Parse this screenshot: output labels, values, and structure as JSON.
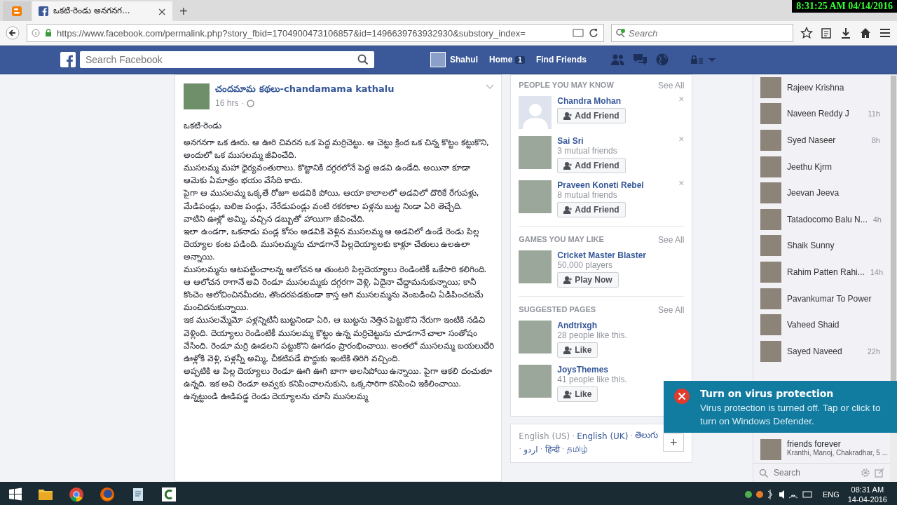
{
  "recorder_clock": "8:31:25 AM 04/14/2016",
  "browser": {
    "tabs": [
      {
        "kind": "pinned",
        "selected": false
      },
      {
        "kind": "page",
        "title": "ఒకటి-రెండు అనగనగ...",
        "close": "×",
        "selected": true
      }
    ],
    "new_tab": "+",
    "url": "https://www.facebook.com/permalink.php?story_fbid=1704900473106857&id=1496639763932930&substory_index=",
    "search_placeholder": "Search"
  },
  "facebook": {
    "search_placeholder": "Search Facebook",
    "user": "Shahul",
    "nav": [
      {
        "label": "Home",
        "badge": "1"
      },
      {
        "label": "Find Friends"
      }
    ]
  },
  "post": {
    "page_name": "చందమామ కథలు-chandamama kathalu",
    "time": "16 hrs",
    "separator": "·",
    "title": "ఒకటి-రెండు",
    "paragraphs": [
      "అనగనగా ఒక ఊరు. ఆ ఊరి చివరన ఒక పెద్ద మర్రిచెట్టు. ఆ చెట్టు క్రింద ఒక చిన్న కొట్టం కట్టుకొని, అందులో ఒక ముసలమ్మ జీవించేది.",
      "ముసలమ్మ మహా ధైర్యవంతురాలు. కొట్టానికి దగ్గరలోనే పెద్ద అడవి ఉండేది. అయినా కూడా ఆమెకు ఏమాత్రం భయం వేసేది కాదు.",
      "పైగా ఆ ముసలమ్మ ఒక్కతే రోజూ అడవికి పోయి, ఆయా కాలాలలో అడవిలో దొరికే రేగుపళ్లు, మేడిపండ్లు, బలిజ పండ్లు, నేరేడుపండ్లు వంటి రకరకాల పళ్లను బుట్ట నిండా ఏరి తెచ్చేది.",
      "వాటిని ఊళ్లో అమ్మి, వచ్చిన డబ్బుతో హాయిగా జీవించేది.",
      "ఇలా ఉండగా, ఒకనాడు పండ్ల కోసం అడవికి వెళ్లిన ముసలమ్మ ఆ అడవిలో ఉండే రెండు పిల్ల దెయ్యాల కంట పడింది. ముసలమ్మను చూడగానే పిల్లదెయ్యాలకు కాళ్లూ చేతులు ఉలఉలా అన్నాయి.",
      "ముసలమ్మను ఆటపట్టించాలన్న ఆలోచన ఆ తుంటరి పిల్లదెయ్యాలు రెండింటికీ ఒకేసారి కలిగింది. ఆ ఆలోచన రాగానే అవి రెండూ ముసలమ్మకు దగ్గరగా వెళ్లి, ఏదైనా చేద్దామనుకున్నాయి; కానీ కొంచెం ఆలోచించినమీదట, తొందరపడకుండా కాస్త ఆగి ముసలమ్మను వెంబడించి ఏడిపించటమే మంచిదనుకున్నాయి.",
      "ఇక ముసలమ్మేమో పళ్లన్నిటినీ బుట్టనిండా ఏరి, ఆ బుట్టను నెత్తిన పెట్టుకొని నేరుగా ఇంటికి నడిచి వెళ్లింది. దెయ్యాలు రెండింటికీ ముసలమ్మ కొట్టం ఉన్న మర్రిచెట్టును చూడగానే చాలా సంతోషం వేసింది. రెండూ మర్రి ఊడలని పట్టుకొని ఊగడం ప్రారంభించాయి. అంతలో ముసలమ్మ బయలుదేరి ఊళ్లోకి వెళ్లి, పళ్లన్నీ అమ్మి, చీకటిపడే పొద్దుకు ఇంటికి తిరిగి వచ్చింది.",
      "అప్పటికి ఆ పిల్ల దెయ్యాలు రెండూ ఊగి ఊగి బాగా అలసిపోయి ఉన్నాయి. పైగా ఆకలి దంచుతూ ఉన్నది. ఇక అవి రెండూ అవ్వకు కనిపించాలనుకుని, ఒక్కసారిగా కనిపించి ఇకిలించాయి.",
      "ఉన్నట్టుండి ఊడిపడ్డ రెండు దెయ్యాలను చూసి ముసలమ్మ"
    ]
  },
  "suggestions": [
    {
      "heading": "PEOPLE YOU MAY KNOW",
      "see_all": "See All",
      "items": [
        {
          "kind": "silhouette",
          "name": "Chandra Mohan",
          "action": "Add Friend",
          "dismiss": "×"
        },
        {
          "kind": "photo",
          "name": "Sai Sri",
          "meta": "3 mutual friends",
          "action": "Add Friend",
          "dismiss": "×"
        },
        {
          "kind": "photo",
          "name": "Praveen Koneti Rebel",
          "meta": "8 mutual friends",
          "action": "Add Friend",
          "dismiss": "×"
        }
      ]
    },
    {
      "heading": "GAMES YOU MAY LIKE",
      "see_all": "See All",
      "items": [
        {
          "kind": "photo",
          "name": "Cricket Master Blaster",
          "meta": "50,000 players",
          "action": "Play Now"
        }
      ]
    },
    {
      "heading": "SUGGESTED PAGES",
      "see_all": "See All",
      "items": [
        {
          "kind": "photo",
          "name": "Andtrixgh",
          "meta": "28 people like this.",
          "action": "Like"
        },
        {
          "kind": "photo",
          "name": "JoysThemes",
          "meta": "41 people like this.",
          "action": "Like"
        }
      ]
    }
  ],
  "languages": {
    "separator": "·",
    "items": [
      {
        "label": "English (US)",
        "selected": true
      },
      {
        "label": "English (UK)",
        "selected": false
      },
      {
        "label": "తెలుగు",
        "selected": false
      },
      {
        "label": "اردو",
        "selected": false
      },
      {
        "label": "हिन्दी",
        "selected": false
      },
      {
        "label": "தமிழ்",
        "selected": false
      }
    ],
    "more": "+"
  },
  "chat": {
    "contacts": [
      {
        "name": "Rajeev Krishna"
      },
      {
        "name": "Naveen Reddy J",
        "time": "11h"
      },
      {
        "name": "Syed Naseer",
        "time": "8h"
      },
      {
        "name": "Jeethu Kjrm"
      },
      {
        "name": "Jeevan Jeeva"
      },
      {
        "name": "Tatadocomo Balu N...",
        "time": "4h"
      },
      {
        "name": "Shaik Sunny"
      },
      {
        "name": "Rahim Patten Rahi...",
        "time": "14h"
      },
      {
        "name": "Pavankumar To Power"
      },
      {
        "name": "Vaheed Shaid"
      },
      {
        "name": "Sayed Naveed",
        "time": "22h"
      }
    ],
    "group": {
      "name": "friends forever",
      "members": "Kranthi, Manoj, Chakradhar, 5 ..."
    },
    "search_placeholder": "Search"
  },
  "toast": {
    "title": "Turn on virus protection",
    "body": "Virus protection is turned off. Tap or click to turn on Windows Defender."
  },
  "taskbar": {
    "apps": [
      {
        "kind": "explorer"
      },
      {
        "kind": "chrome"
      },
      {
        "kind": "firefox"
      },
      {
        "kind": "notes"
      },
      {
        "kind": "recorder"
      }
    ],
    "language": "ENG",
    "time": "08:31 AM",
    "date": "14-04-2016"
  }
}
